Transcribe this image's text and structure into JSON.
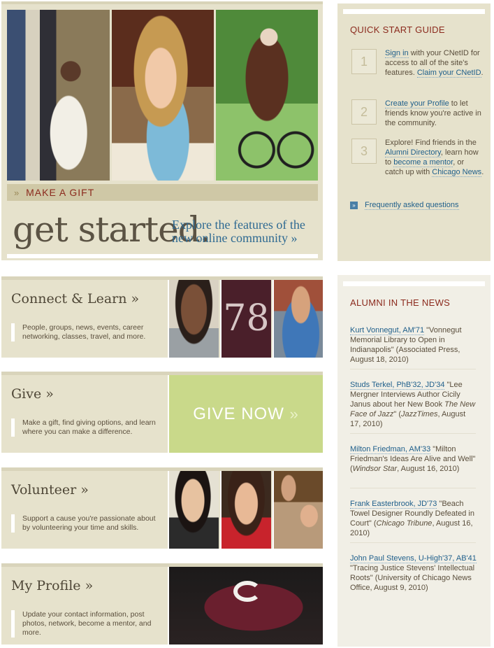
{
  "hero": {
    "gift_chevron": "»",
    "gift_label": "MAKE A GIFT",
    "title": "get started.",
    "subtitle": "Explore the features of the new online community »"
  },
  "quick_start": {
    "heading": "QUICK START GUIDE",
    "steps": [
      {
        "number": "1",
        "parts": [
          {
            "text": "Sign in",
            "link": true
          },
          {
            "text": " with your CNetID for access to all of the site's features. ",
            "link": false
          },
          {
            "text": "Claim your CNetID",
            "link": true
          },
          {
            "text": ".",
            "link": false
          }
        ]
      },
      {
        "number": "2",
        "parts": [
          {
            "text": "Create your Profile",
            "link": true
          },
          {
            "text": " to let friends know you're active in the community.",
            "link": false
          }
        ]
      },
      {
        "number": "3",
        "parts": [
          {
            "text": "Explore! Find friends in the ",
            "link": false
          },
          {
            "text": "Alumni Directory",
            "link": true
          },
          {
            "text": ", learn how to ",
            "link": false
          },
          {
            "text": "become a mentor",
            "link": true
          },
          {
            "text": ", or catch up with ",
            "link": false
          },
          {
            "text": "Chicago News",
            "link": true
          },
          {
            "text": ".",
            "link": false
          }
        ]
      }
    ],
    "faq_label": "Frequently asked questions",
    "faq_icon": "»"
  },
  "panels": {
    "connect": {
      "title": "Connect & Learn »",
      "description": "People, groups, news, events, career networking, classes, travel, and more.",
      "badge_number": "78"
    },
    "give": {
      "title": "Give »",
      "description": "Make a gift, find giving options, and learn where you can make a difference.",
      "give_now": "GIVE NOW",
      "give_now_chevron": "»"
    },
    "volunteer": {
      "title": "Volunteer »",
      "description": "Support a cause you're passionate about by volunteering your time and skills."
    },
    "profile": {
      "title": "My Profile »",
      "description": "Update your contact information, post photos, network, become a mentor, and more."
    }
  },
  "news": {
    "heading": "ALUMNI IN THE NEWS",
    "items": [
      {
        "parts": [
          {
            "text": "Kurt Vonnegut, AM'71",
            "style": "link"
          },
          {
            "text": " \"Vonnegut Memorial Library to Open in Indianapolis\" (Associated Press, August 18, 2010)",
            "style": "plain"
          }
        ]
      },
      {
        "parts": [
          {
            "text": "Studs Terkel, PhB'32, JD'34",
            "style": "link"
          },
          {
            "text": " \"Lee Mergner Interviews Author Cicily Janus about her New Book ",
            "style": "plain"
          },
          {
            "text": "The New Face of Jazz",
            "style": "italic"
          },
          {
            "text": "\" (",
            "style": "plain"
          },
          {
            "text": "JazzTimes",
            "style": "italic"
          },
          {
            "text": ", August 17, 2010)",
            "style": "plain"
          }
        ]
      },
      {
        "parts": [
          {
            "text": "Milton Friedman, AM'33",
            "style": "link"
          },
          {
            "text": " \"Milton Friedman's Ideas Are Alive and Well\" (",
            "style": "plain"
          },
          {
            "text": "Windsor Star",
            "style": "italic"
          },
          {
            "text": ", August 16, 2010)",
            "style": "plain"
          }
        ]
      },
      {
        "parts": [
          {
            "text": "Frank Easterbrook, JD'73",
            "style": "link"
          },
          {
            "text": " \"Beach Towel Designer Roundly Defeated in Court\" (",
            "style": "plain"
          },
          {
            "text": "Chicago Tribune",
            "style": "italic"
          },
          {
            "text": ", August 16, 2010)",
            "style": "plain"
          }
        ]
      },
      {
        "parts": [
          {
            "text": "John Paul Stevens, U-High'37, AB'41",
            "style": "link"
          },
          {
            "text": " \"Tracing Justice Stevens' Intellectual Roots\" (University of Chicago News Office, August 9, 2010)",
            "style": "plain"
          }
        ]
      }
    ]
  },
  "colors": {
    "panel_bg": "#e6e2cc",
    "accent_red": "#8b2a1d",
    "link_blue": "#1f5f8b",
    "give_green": "#c9d98a"
  }
}
